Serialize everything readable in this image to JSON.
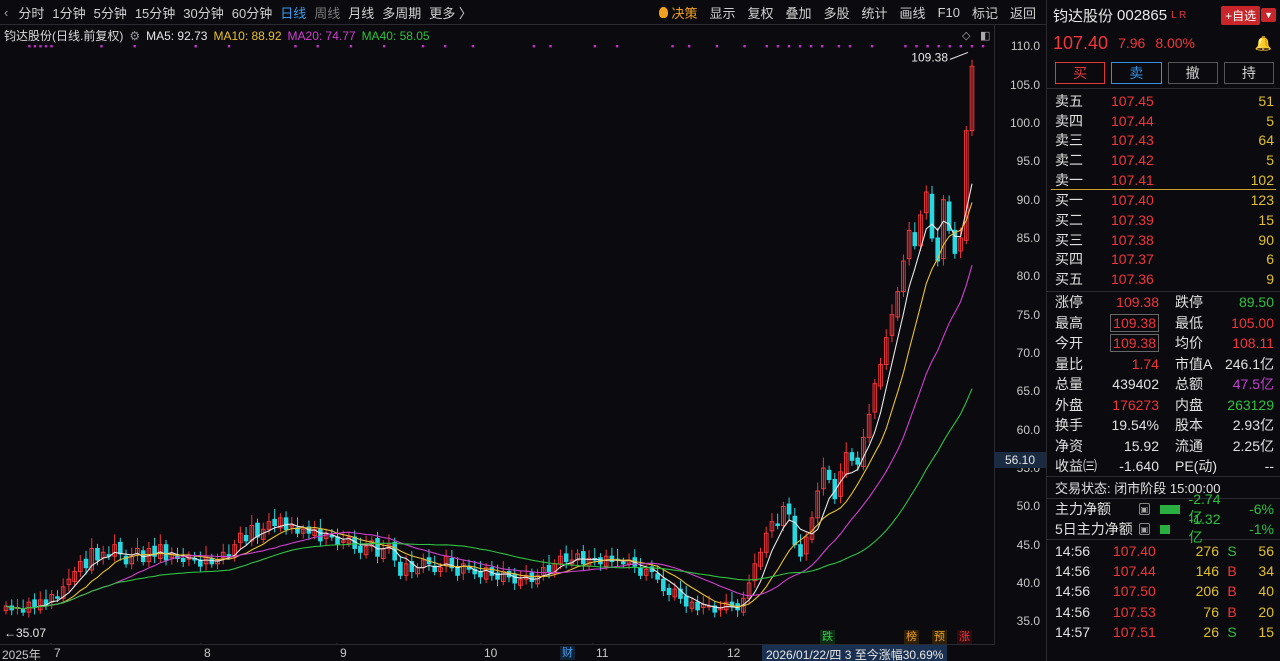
{
  "toolbar": {
    "back_symbol": "‹",
    "periods": [
      "分时",
      "1分钟",
      "5分钟",
      "15分钟",
      "30分钟",
      "60分钟",
      "日线",
      "周线",
      "月线",
      "多周期",
      "更多 〉"
    ],
    "active_period": "日线",
    "right_items": {
      "juece": "决策",
      "display": "显示",
      "fuquan": "复权",
      "overlay": "叠加",
      "multi": "多股",
      "stats": "统计",
      "draw": "画线",
      "f10": "F10",
      "mark": "标记",
      "back": "返回"
    }
  },
  "legend": {
    "stock": "钧达股份(日线.前复权)",
    "ma5": "MA5: 92.73",
    "ma10": "MA10: 88.92",
    "ma20": "MA20: 74.77",
    "ma40": "MA40: 58.05"
  },
  "chart": {
    "max_label": "109.38",
    "min_label": "←35.07",
    "last_price_tag": "56.10",
    "y_ticks": [
      "110.0",
      "105.0",
      "100.0",
      "95.0",
      "90.0",
      "85.0",
      "80.0",
      "75.0",
      "70.0",
      "65.0",
      "60.0",
      "55.0",
      "50.0",
      "45.0",
      "40.0",
      "35.0"
    ],
    "x_labels": [
      "2025年",
      "7",
      "8",
      "9",
      "10",
      "11",
      "12"
    ],
    "date_tip": "2026/01/22/四 3 至今涨幅30.69%",
    "markers": {
      "cai": "财",
      "die": "跌",
      "bang": "榜",
      "yu": "预",
      "zhang": "涨"
    },
    "colors": {
      "up": "#f0363a",
      "down": "#28d8e0",
      "ma5": "#e8e8e8",
      "ma10": "#e8c030",
      "ma20": "#d040d0",
      "ma40": "#30c040"
    }
  },
  "chart_data": {
    "type": "candlestick",
    "title": "钧达股份(日线.前复权)",
    "ylim": [
      34,
      112
    ],
    "y_ticks": [
      110,
      105,
      100,
      95,
      90,
      85,
      80,
      75,
      70,
      65,
      60,
      55,
      50,
      45,
      40,
      35
    ],
    "x_tick_labels": [
      "2025年",
      "7",
      "8",
      "9",
      "10",
      "11",
      "12"
    ],
    "series_ma": [
      {
        "name": "MA5",
        "last": 92.73
      },
      {
        "name": "MA10",
        "last": 88.92
      },
      {
        "name": "MA20",
        "last": 74.77
      },
      {
        "name": "MA40",
        "last": 58.05
      }
    ],
    "close": [
      37.0,
      36.5,
      36.8,
      36.2,
      37.5,
      36.8,
      37.8,
      37.2,
      38.5,
      38.0,
      39.5,
      40.5,
      41.5,
      42.8,
      42.0,
      44.5,
      43.0,
      44.0,
      43.5,
      45.0,
      43.8,
      42.5,
      43.5,
      44.5,
      42.8,
      44.5,
      43.5,
      45.0,
      43.0,
      43.8,
      43.2,
      42.8,
      43.5,
      43.0,
      42.2,
      43.5,
      42.5,
      43.0,
      44.0,
      43.5,
      45.0,
      46.5,
      45.5,
      47.5,
      46.0,
      47.0,
      48.0,
      47.5,
      48.5,
      47.0,
      47.5,
      46.5,
      47.0,
      46.5,
      47.0,
      45.5,
      46.5,
      46.0,
      45.0,
      45.5,
      46.0,
      44.5,
      44.0,
      44.8,
      45.5,
      43.5,
      44.5,
      45.0,
      43.0,
      41.0,
      42.5,
      41.5,
      42.0,
      43.0,
      42.5,
      41.5,
      42.0,
      43.5,
      42.0,
      41.0,
      42.5,
      41.8,
      41.2,
      40.8,
      42.0,
      41.0,
      40.5,
      41.5,
      40.8,
      40.0,
      40.5,
      41.0,
      40.2,
      41.0,
      42.0,
      41.5,
      42.5,
      43.5,
      42.8,
      43.0,
      43.8,
      42.5,
      43.2,
      43.0,
      42.5,
      43.5,
      42.8,
      43.0,
      42.5,
      43.0,
      42.2,
      41.0,
      41.8,
      41.5,
      40.5,
      39.0,
      38.5,
      39.2,
      38.0,
      37.0,
      37.5,
      36.5,
      37.2,
      37.0,
      36.2,
      36.8,
      37.5,
      37.0,
      36.5,
      38.0,
      40.0,
      42.5,
      44.0,
      46.5,
      48.0,
      47.5,
      50.0,
      49.0,
      45.0,
      43.5,
      46.0,
      48.5,
      52.0,
      55.0,
      53.5,
      51.0,
      54.5,
      57.0,
      56.0,
      55.5,
      59.0,
      62.0,
      66.0,
      68.5,
      72.0,
      75.0,
      78.0,
      82.0,
      86.0,
      84.0,
      88.0,
      91.0,
      85.0,
      82.0,
      90.0,
      86.0,
      83.0,
      85.0,
      99.0,
      107.4
    ]
  },
  "panel": {
    "name": "钧达股份",
    "code": "002865",
    "flags": "L R",
    "add_label": "+自选",
    "drop_symbol": "▼",
    "last": "107.40",
    "change": "7.96",
    "pct": "8.00%",
    "bell": "🔔",
    "buttons": {
      "buy": "买",
      "sell": "卖",
      "cancel": "撤",
      "hold": "持"
    },
    "asks": [
      {
        "label": "卖五",
        "price": "107.45",
        "vol": "51"
      },
      {
        "label": "卖四",
        "price": "107.44",
        "vol": "5"
      },
      {
        "label": "卖三",
        "price": "107.43",
        "vol": "64"
      },
      {
        "label": "卖二",
        "price": "107.42",
        "vol": "5"
      },
      {
        "label": "卖一",
        "price": "107.41",
        "vol": "102"
      }
    ],
    "bids": [
      {
        "label": "买一",
        "price": "107.40",
        "vol": "123"
      },
      {
        "label": "买二",
        "price": "107.39",
        "vol": "15"
      },
      {
        "label": "买三",
        "price": "107.38",
        "vol": "90"
      },
      {
        "label": "买四",
        "price": "107.37",
        "vol": "6"
      },
      {
        "label": "买五",
        "price": "107.36",
        "vol": "9"
      }
    ],
    "stats": [
      {
        "k": "涨停",
        "v": "109.38",
        "vc": "red",
        "k2": "跌停",
        "v2": "89.50",
        "v2c": "green"
      },
      {
        "k": "最高",
        "v": "109.38",
        "vc": "red boxed",
        "k2": "最低",
        "v2": "105.00",
        "v2c": "red"
      },
      {
        "k": "今开",
        "v": "109.38",
        "vc": "red boxed",
        "k2": "均价",
        "v2": "108.11",
        "v2c": "red"
      },
      {
        "k": "量比",
        "v": "1.74",
        "vc": "red",
        "k2": "市值A",
        "v2": "246.1亿",
        "v2c": "white"
      },
      {
        "k": "总量",
        "v": "439402",
        "vc": "white",
        "k2": "总额",
        "v2": "47.5亿",
        "v2c": "purple"
      },
      {
        "k": "外盘",
        "v": "176273",
        "vc": "red",
        "k2": "内盘",
        "v2": "263129",
        "v2c": "green"
      },
      {
        "k": "换手",
        "v": "19.54%",
        "vc": "white",
        "k2": "股本",
        "v2": "2.93亿",
        "v2c": "white"
      },
      {
        "k": "净资",
        "v": "15.92",
        "vc": "white",
        "k2": "流通",
        "v2": "2.25亿",
        "v2c": "white"
      },
      {
        "k": "收益㈢",
        "v": "-1.640",
        "vc": "white",
        "k2": "PE(动)",
        "v2": "--",
        "v2c": "white"
      }
    ],
    "trade_status": "交易状态: 闭市阶段 15:00:00",
    "flows": [
      {
        "label": "主力净额",
        "value": "-2.74亿",
        "pct": "-6%",
        "bar": 0.7
      },
      {
        "label": "5日主力净额",
        "value": "-1.32亿",
        "pct": "-1%",
        "bar": 0.35
      }
    ],
    "flow_icon": "▣",
    "ticks": [
      {
        "t": "14:56",
        "px": "107.40",
        "vol": "276",
        "bs": "S",
        "n": "56"
      },
      {
        "t": "14:56",
        "px": "107.44",
        "vol": "146",
        "bs": "B",
        "n": "34"
      },
      {
        "t": "14:56",
        "px": "107.50",
        "vol": "206",
        "bs": "B",
        "n": "40"
      },
      {
        "t": "14:56",
        "px": "107.53",
        "vol": "76",
        "bs": "B",
        "n": "20"
      },
      {
        "t": "14:57",
        "px": "107.51",
        "vol": "26",
        "bs": "S",
        "n": "15"
      }
    ]
  }
}
